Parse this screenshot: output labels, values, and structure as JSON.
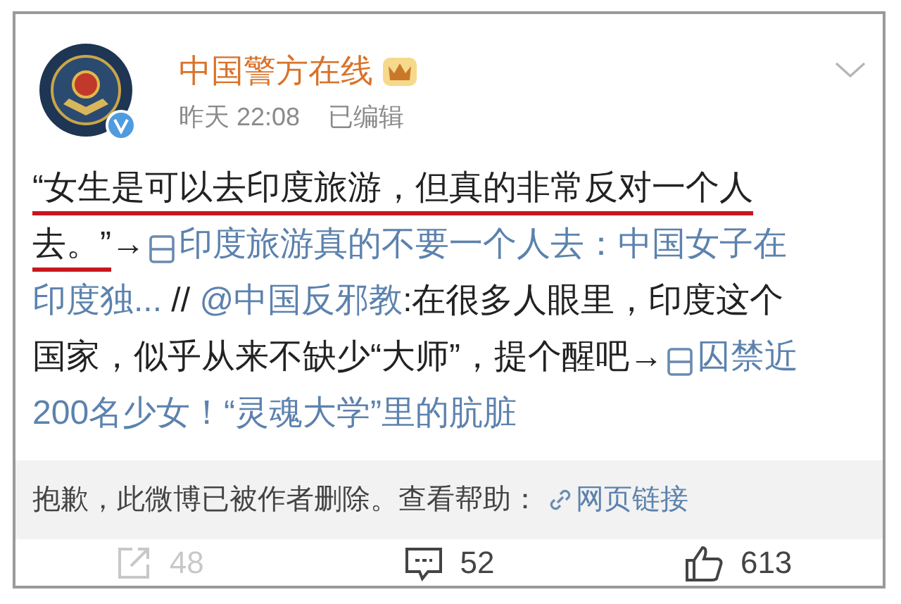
{
  "author": {
    "name": "中国警方在线",
    "verified": true,
    "time": "昨天 22:08",
    "edited": "已编辑"
  },
  "body_lines": [
    [
      {
        "kind": "highlight",
        "text": "“女生是可以去印度旅游，但真的非常反对一个人"
      }
    ],
    [
      {
        "kind": "highlight",
        "text": "去。”"
      },
      {
        "kind": "text",
        "text": "→"
      },
      {
        "kind": "link",
        "icon": true,
        "text": "印度旅游真的不要一个人去：中国女子在"
      }
    ],
    [
      {
        "kind": "link",
        "icon": false,
        "text": "印度独..."
      },
      {
        "kind": "text",
        "text": " // "
      },
      {
        "kind": "link",
        "icon": false,
        "text": "@中国反邪教"
      },
      {
        "kind": "text",
        "text": ":在很多人眼里，印度这个"
      }
    ],
    [
      {
        "kind": "text",
        "text": "国家，似乎从来不缺少“大师”，提个醒吧→"
      },
      {
        "kind": "link",
        "icon": true,
        "text": "囚禁近"
      }
    ],
    [
      {
        "kind": "link",
        "icon": false,
        "text": "200名少女！“灵魂大学”里的肮脏"
      }
    ]
  ],
  "deleted_notice": {
    "text": "抱歉，此微博已被作者删除。查看帮助：",
    "link": "网页链接"
  },
  "actions": [
    {
      "kind": "repost",
      "count": "48",
      "disabled": true
    },
    {
      "kind": "comment",
      "count": "52",
      "disabled": false
    },
    {
      "kind": "like",
      "count": "613",
      "disabled": false
    }
  ]
}
